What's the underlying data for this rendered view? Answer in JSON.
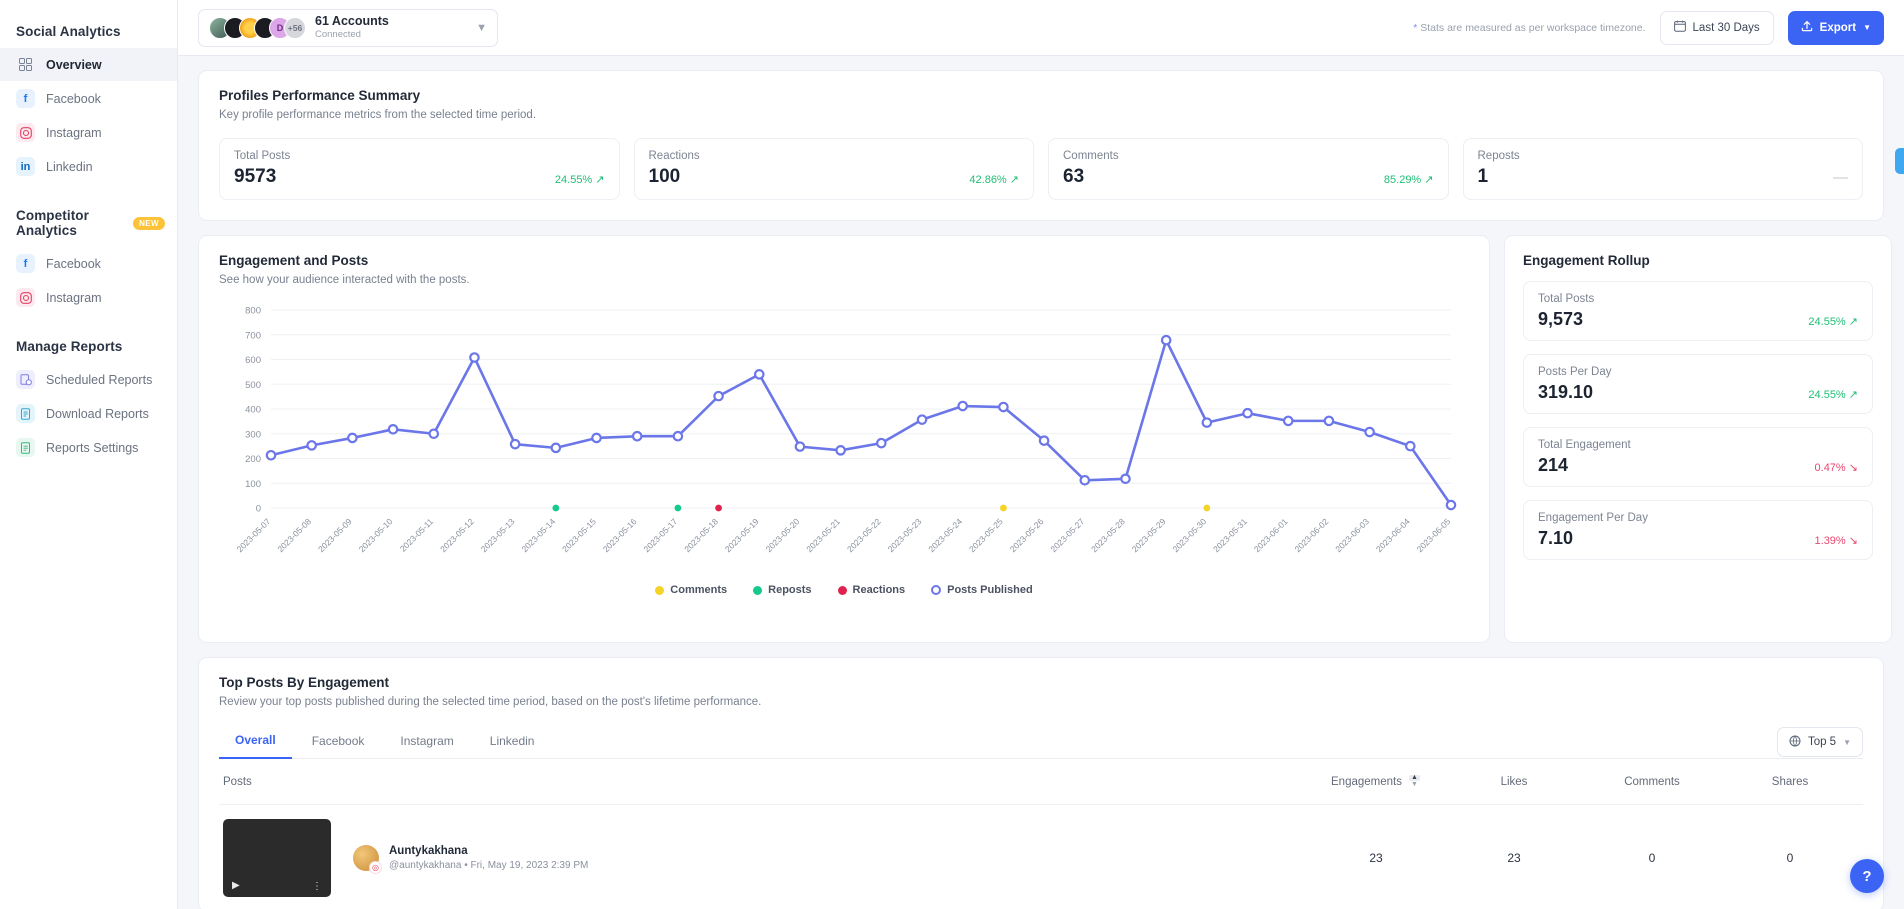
{
  "sidebar": {
    "groups": [
      {
        "title": "Social Analytics",
        "items": [
          {
            "label": "Overview",
            "icon": "grid-icon"
          },
          {
            "label": "Facebook",
            "icon": "facebook-icon"
          },
          {
            "label": "Instagram",
            "icon": "instagram-icon"
          },
          {
            "label": "Linkedin",
            "icon": "linkedin-icon"
          }
        ]
      },
      {
        "title": "Competitor Analytics",
        "badge": "NEW",
        "items": [
          {
            "label": "Facebook",
            "icon": "facebook-icon"
          },
          {
            "label": "Instagram",
            "icon": "instagram-icon"
          }
        ]
      },
      {
        "title": "Manage Reports",
        "items": [
          {
            "label": "Scheduled Reports",
            "icon": "scheduled-reports-icon"
          },
          {
            "label": "Download Reports",
            "icon": "download-reports-icon"
          },
          {
            "label": "Reports Settings",
            "icon": "reports-settings-icon"
          }
        ]
      }
    ]
  },
  "topbar": {
    "account_title": "61 Accounts",
    "account_sub": "Connected",
    "avatar_more": "+56",
    "avatar_letter": "D",
    "stats_note": "Stats are measured as per workspace timezone.",
    "date_range": "Last 30 Days",
    "export_label": "Export"
  },
  "summary": {
    "title": "Profiles Performance Summary",
    "subtitle": "Key profile performance metrics from the selected time period.",
    "cards": [
      {
        "label": "Total Posts",
        "value": "9573",
        "delta": "24.55%",
        "trend": "up"
      },
      {
        "label": "Reactions",
        "value": "100",
        "delta": "42.86%",
        "trend": "up"
      },
      {
        "label": "Comments",
        "value": "63",
        "delta": "85.29%",
        "trend": "up"
      },
      {
        "label": "Reposts",
        "value": "1",
        "delta": "—",
        "trend": "flat"
      }
    ]
  },
  "engagement": {
    "title": "Engagement and Posts",
    "subtitle": "See how your audience interacted with the posts."
  },
  "rollup": {
    "title": "Engagement Rollup",
    "items": [
      {
        "label": "Total Posts",
        "value": "9,573",
        "delta": "24.55%",
        "trend": "up"
      },
      {
        "label": "Posts Per Day",
        "value": "319.10",
        "delta": "24.55%",
        "trend": "up"
      },
      {
        "label": "Total Engagement",
        "value": "214",
        "delta": "0.47%",
        "trend": "down"
      },
      {
        "label": "Engagement Per Day",
        "value": "7.10",
        "delta": "1.39%",
        "trend": "down"
      }
    ]
  },
  "top_posts": {
    "title": "Top Posts By Engagement",
    "subtitle": "Review your top posts published during the selected time period, based on the post's lifetime performance.",
    "tabs": [
      "Overall",
      "Facebook",
      "Instagram",
      "Linkedin"
    ],
    "active_tab": "Overall",
    "top_selector": "Top 5",
    "columns": [
      "Posts",
      "Engagements",
      "Likes",
      "Comments",
      "Shares"
    ],
    "rows": [
      {
        "name": "Auntykakhana",
        "handle": "@auntykakhana",
        "date": "Fri, May 19, 2023 2:39 PM",
        "engagements": "23",
        "likes": "23",
        "comments": "0",
        "shares": "0"
      }
    ]
  },
  "help": {
    "label": "?"
  },
  "chart_data": {
    "type": "line",
    "title": "Engagement and Posts",
    "xlabel": "",
    "ylabel": "",
    "ylim": [
      0,
      800
    ],
    "yticks": [
      0,
      100,
      200,
      300,
      400,
      500,
      600,
      700,
      800
    ],
    "grid": true,
    "legend_position": "bottom",
    "legend": [
      "Comments",
      "Reposts",
      "Reactions",
      "Posts Published"
    ],
    "colors": {
      "Comments": "#f5d327",
      "Reposts": "#16c98d",
      "Reactions": "#e0234e",
      "Posts Published": "#6b76e8"
    },
    "x": [
      "2023-05-07",
      "2023-05-08",
      "2023-05-09",
      "2023-05-10",
      "2023-05-11",
      "2023-05-12",
      "2023-05-13",
      "2023-05-14",
      "2023-05-15",
      "2023-05-16",
      "2023-05-17",
      "2023-05-18",
      "2023-05-19",
      "2023-05-20",
      "2023-05-21",
      "2023-05-22",
      "2023-05-23",
      "2023-05-24",
      "2023-05-25",
      "2023-05-26",
      "2023-05-27",
      "2023-05-28",
      "2023-05-29",
      "2023-05-30",
      "2023-05-31",
      "2023-06-01",
      "2023-06-02",
      "2023-06-03",
      "2023-06-04",
      "2023-06-05"
    ],
    "series": [
      {
        "name": "Posts Published",
        "type": "line",
        "values": [
          213,
          253,
          283,
          318,
          300,
          608,
          258,
          243,
          283,
          290,
          290,
          452,
          540,
          248,
          233,
          262,
          357,
          412,
          408,
          272,
          112,
          118,
          678,
          345,
          383,
          352,
          352,
          307,
          250,
          12
        ]
      },
      {
        "name": "Comments",
        "type": "marker",
        "points": [
          {
            "x": "2023-05-25",
            "y": 0
          },
          {
            "x": "2023-05-30",
            "y": 0
          }
        ]
      },
      {
        "name": "Reposts",
        "type": "marker",
        "points": [
          {
            "x": "2023-05-14",
            "y": 0
          },
          {
            "x": "2023-05-17",
            "y": 0
          }
        ]
      },
      {
        "name": "Reactions",
        "type": "marker",
        "points": [
          {
            "x": "2023-05-18",
            "y": 0
          }
        ]
      }
    ]
  }
}
